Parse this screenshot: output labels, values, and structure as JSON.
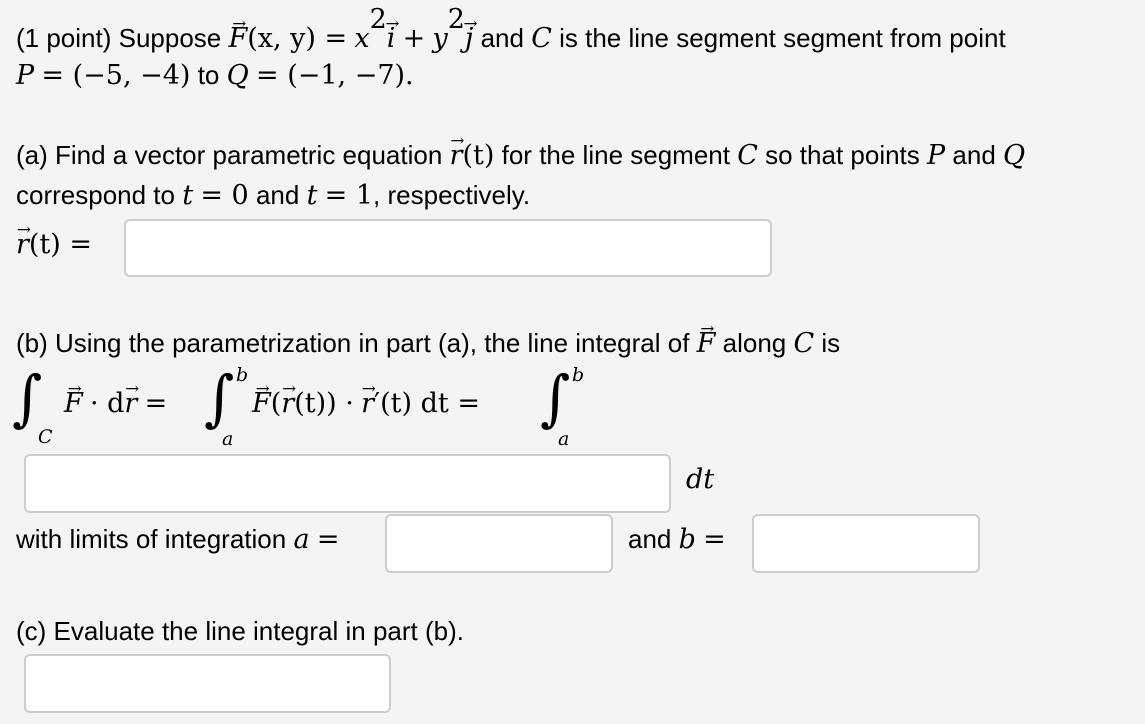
{
  "intro": {
    "points_label": "(1 point) Suppose",
    "field_fn": "F",
    "field_args": "(x, y) =",
    "term1": "x",
    "term1_exp": "2",
    "term1_unit": "i",
    "plus": "+",
    "term2": "y",
    "term2_exp": "2",
    "term2_unit": "j",
    "text_and": "and",
    "curve": "C",
    "text_segment": "is the line segment segment from point",
    "P_label": "P",
    "P_value": "= (−5, −4)",
    "text_to": "to",
    "Q_label": "Q",
    "Q_value": "= (−1, −7).",
    "period": ""
  },
  "part_a": {
    "text1": "(a) Find a vector parametric equation",
    "r": "r",
    "r_args": "(t)",
    "text2": "for the line segment",
    "curve": "C",
    "text3": "so that points",
    "P": "P",
    "text_and": "and",
    "Q": "Q",
    "text4": "correspond to",
    "t": "t",
    "eq0": "= 0",
    "text_and2": "and",
    "eq1": "= 1",
    "text5": ", respectively.",
    "answer_label_r": "r",
    "answer_label_rest": "(t) =",
    "answer_value": ""
  },
  "part_b": {
    "text1": "(b) Using the parametrization in part (a), the line integral of",
    "F": "F",
    "text2": "along",
    "curve": "C",
    "text3": "is",
    "int_sub_C": "C",
    "lhs_F": "F",
    "lhs_dot": "· d",
    "lhs_r": "r",
    "eq": "=",
    "upper": "b",
    "lower": "a",
    "mid_F": "F",
    "mid_open": "(",
    "mid_r": "r",
    "mid_t": "(t)) ·",
    "mid_rp": "r",
    "mid_rest": "′(t) dt =",
    "integrand_value": "",
    "dt": "dt",
    "limits_text": "with limits of integration",
    "a": "a",
    "a_eq": "=",
    "a_value": "",
    "and_text": "and",
    "b": "b",
    "b_eq": "=",
    "b_value": ""
  },
  "part_c": {
    "text": "(c) Evaluate the line integral in part (b).",
    "answer_value": ""
  }
}
